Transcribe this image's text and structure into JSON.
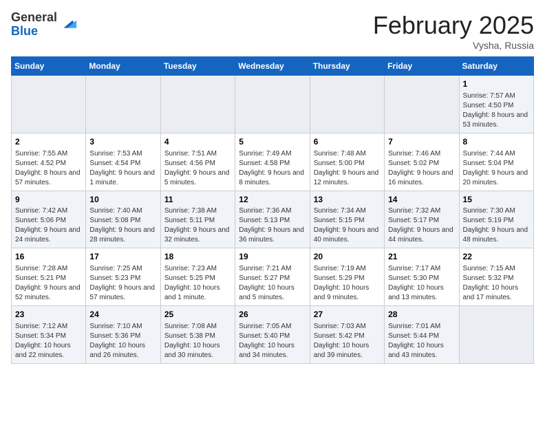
{
  "header": {
    "logo_line1": "General",
    "logo_line2": "Blue",
    "month": "February 2025",
    "location": "Vysha, Russia"
  },
  "days_of_week": [
    "Sunday",
    "Monday",
    "Tuesday",
    "Wednesday",
    "Thursday",
    "Friday",
    "Saturday"
  ],
  "weeks": [
    [
      {
        "day": "",
        "info": ""
      },
      {
        "day": "",
        "info": ""
      },
      {
        "day": "",
        "info": ""
      },
      {
        "day": "",
        "info": ""
      },
      {
        "day": "",
        "info": ""
      },
      {
        "day": "",
        "info": ""
      },
      {
        "day": "1",
        "info": "Sunrise: 7:57 AM\nSunset: 4:50 PM\nDaylight: 8 hours and 53 minutes."
      }
    ],
    [
      {
        "day": "2",
        "info": "Sunrise: 7:55 AM\nSunset: 4:52 PM\nDaylight: 8 hours and 57 minutes."
      },
      {
        "day": "3",
        "info": "Sunrise: 7:53 AM\nSunset: 4:54 PM\nDaylight: 9 hours and 1 minute."
      },
      {
        "day": "4",
        "info": "Sunrise: 7:51 AM\nSunset: 4:56 PM\nDaylight: 9 hours and 5 minutes."
      },
      {
        "day": "5",
        "info": "Sunrise: 7:49 AM\nSunset: 4:58 PM\nDaylight: 9 hours and 8 minutes."
      },
      {
        "day": "6",
        "info": "Sunrise: 7:48 AM\nSunset: 5:00 PM\nDaylight: 9 hours and 12 minutes."
      },
      {
        "day": "7",
        "info": "Sunrise: 7:46 AM\nSunset: 5:02 PM\nDaylight: 9 hours and 16 minutes."
      },
      {
        "day": "8",
        "info": "Sunrise: 7:44 AM\nSunset: 5:04 PM\nDaylight: 9 hours and 20 minutes."
      }
    ],
    [
      {
        "day": "9",
        "info": "Sunrise: 7:42 AM\nSunset: 5:06 PM\nDaylight: 9 hours and 24 minutes."
      },
      {
        "day": "10",
        "info": "Sunrise: 7:40 AM\nSunset: 5:08 PM\nDaylight: 9 hours and 28 minutes."
      },
      {
        "day": "11",
        "info": "Sunrise: 7:38 AM\nSunset: 5:11 PM\nDaylight: 9 hours and 32 minutes."
      },
      {
        "day": "12",
        "info": "Sunrise: 7:36 AM\nSunset: 5:13 PM\nDaylight: 9 hours and 36 minutes."
      },
      {
        "day": "13",
        "info": "Sunrise: 7:34 AM\nSunset: 5:15 PM\nDaylight: 9 hours and 40 minutes."
      },
      {
        "day": "14",
        "info": "Sunrise: 7:32 AM\nSunset: 5:17 PM\nDaylight: 9 hours and 44 minutes."
      },
      {
        "day": "15",
        "info": "Sunrise: 7:30 AM\nSunset: 5:19 PM\nDaylight: 9 hours and 48 minutes."
      }
    ],
    [
      {
        "day": "16",
        "info": "Sunrise: 7:28 AM\nSunset: 5:21 PM\nDaylight: 9 hours and 52 minutes."
      },
      {
        "day": "17",
        "info": "Sunrise: 7:25 AM\nSunset: 5:23 PM\nDaylight: 9 hours and 57 minutes."
      },
      {
        "day": "18",
        "info": "Sunrise: 7:23 AM\nSunset: 5:25 PM\nDaylight: 10 hours and 1 minute."
      },
      {
        "day": "19",
        "info": "Sunrise: 7:21 AM\nSunset: 5:27 PM\nDaylight: 10 hours and 5 minutes."
      },
      {
        "day": "20",
        "info": "Sunrise: 7:19 AM\nSunset: 5:29 PM\nDaylight: 10 hours and 9 minutes."
      },
      {
        "day": "21",
        "info": "Sunrise: 7:17 AM\nSunset: 5:30 PM\nDaylight: 10 hours and 13 minutes."
      },
      {
        "day": "22",
        "info": "Sunrise: 7:15 AM\nSunset: 5:32 PM\nDaylight: 10 hours and 17 minutes."
      }
    ],
    [
      {
        "day": "23",
        "info": "Sunrise: 7:12 AM\nSunset: 5:34 PM\nDaylight: 10 hours and 22 minutes."
      },
      {
        "day": "24",
        "info": "Sunrise: 7:10 AM\nSunset: 5:36 PM\nDaylight: 10 hours and 26 minutes."
      },
      {
        "day": "25",
        "info": "Sunrise: 7:08 AM\nSunset: 5:38 PM\nDaylight: 10 hours and 30 minutes."
      },
      {
        "day": "26",
        "info": "Sunrise: 7:05 AM\nSunset: 5:40 PM\nDaylight: 10 hours and 34 minutes."
      },
      {
        "day": "27",
        "info": "Sunrise: 7:03 AM\nSunset: 5:42 PM\nDaylight: 10 hours and 39 minutes."
      },
      {
        "day": "28",
        "info": "Sunrise: 7:01 AM\nSunset: 5:44 PM\nDaylight: 10 hours and 43 minutes."
      },
      {
        "day": "",
        "info": ""
      }
    ]
  ]
}
